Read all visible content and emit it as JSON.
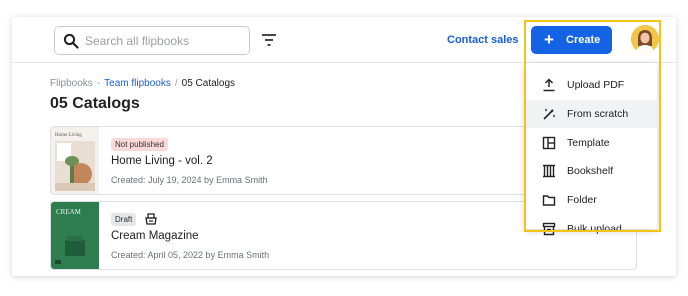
{
  "topbar": {
    "search_placeholder": "Search all flipbooks",
    "contact_label": "Contact sales",
    "create_label": "Create",
    "icons": [
      "search-icon",
      "filter-icon",
      "plus-icon",
      "avatar"
    ]
  },
  "breadcrumb": {
    "items": [
      "Flipbooks",
      "Team flipbooks",
      "05 Catalogs"
    ],
    "separators": [
      "-",
      "/"
    ]
  },
  "page_title": "05 Catalogs",
  "flipbooks": [
    {
      "cover_text": "Home Living",
      "status": "Not published",
      "name": "Home Living - vol. 2",
      "meta": "Created: July 19, 2024 by Emma Smith"
    },
    {
      "cover_text": "CREAM",
      "status": "Draft",
      "name": "Cream Magazine",
      "meta": "Created: April 05, 2022 by Emma Smith"
    }
  ],
  "create_menu": {
    "items": [
      {
        "label": "Upload PDF",
        "icon": "upload-icon"
      },
      {
        "label": "From scratch",
        "icon": "magic-wand-icon"
      },
      {
        "label": "Template",
        "icon": "template-icon"
      },
      {
        "label": "Bookshelf",
        "icon": "bookshelf-icon"
      },
      {
        "label": "Folder",
        "icon": "folder-icon"
      },
      {
        "label": "Bulk upload",
        "icon": "archive-icon"
      }
    ]
  },
  "colors": {
    "accent": "#1563e5",
    "link": "#1a5fd8",
    "highlight_border": "#f2c418",
    "badge_not_published": "#fbd9d9",
    "badge_draft": "#e4e6ea"
  }
}
